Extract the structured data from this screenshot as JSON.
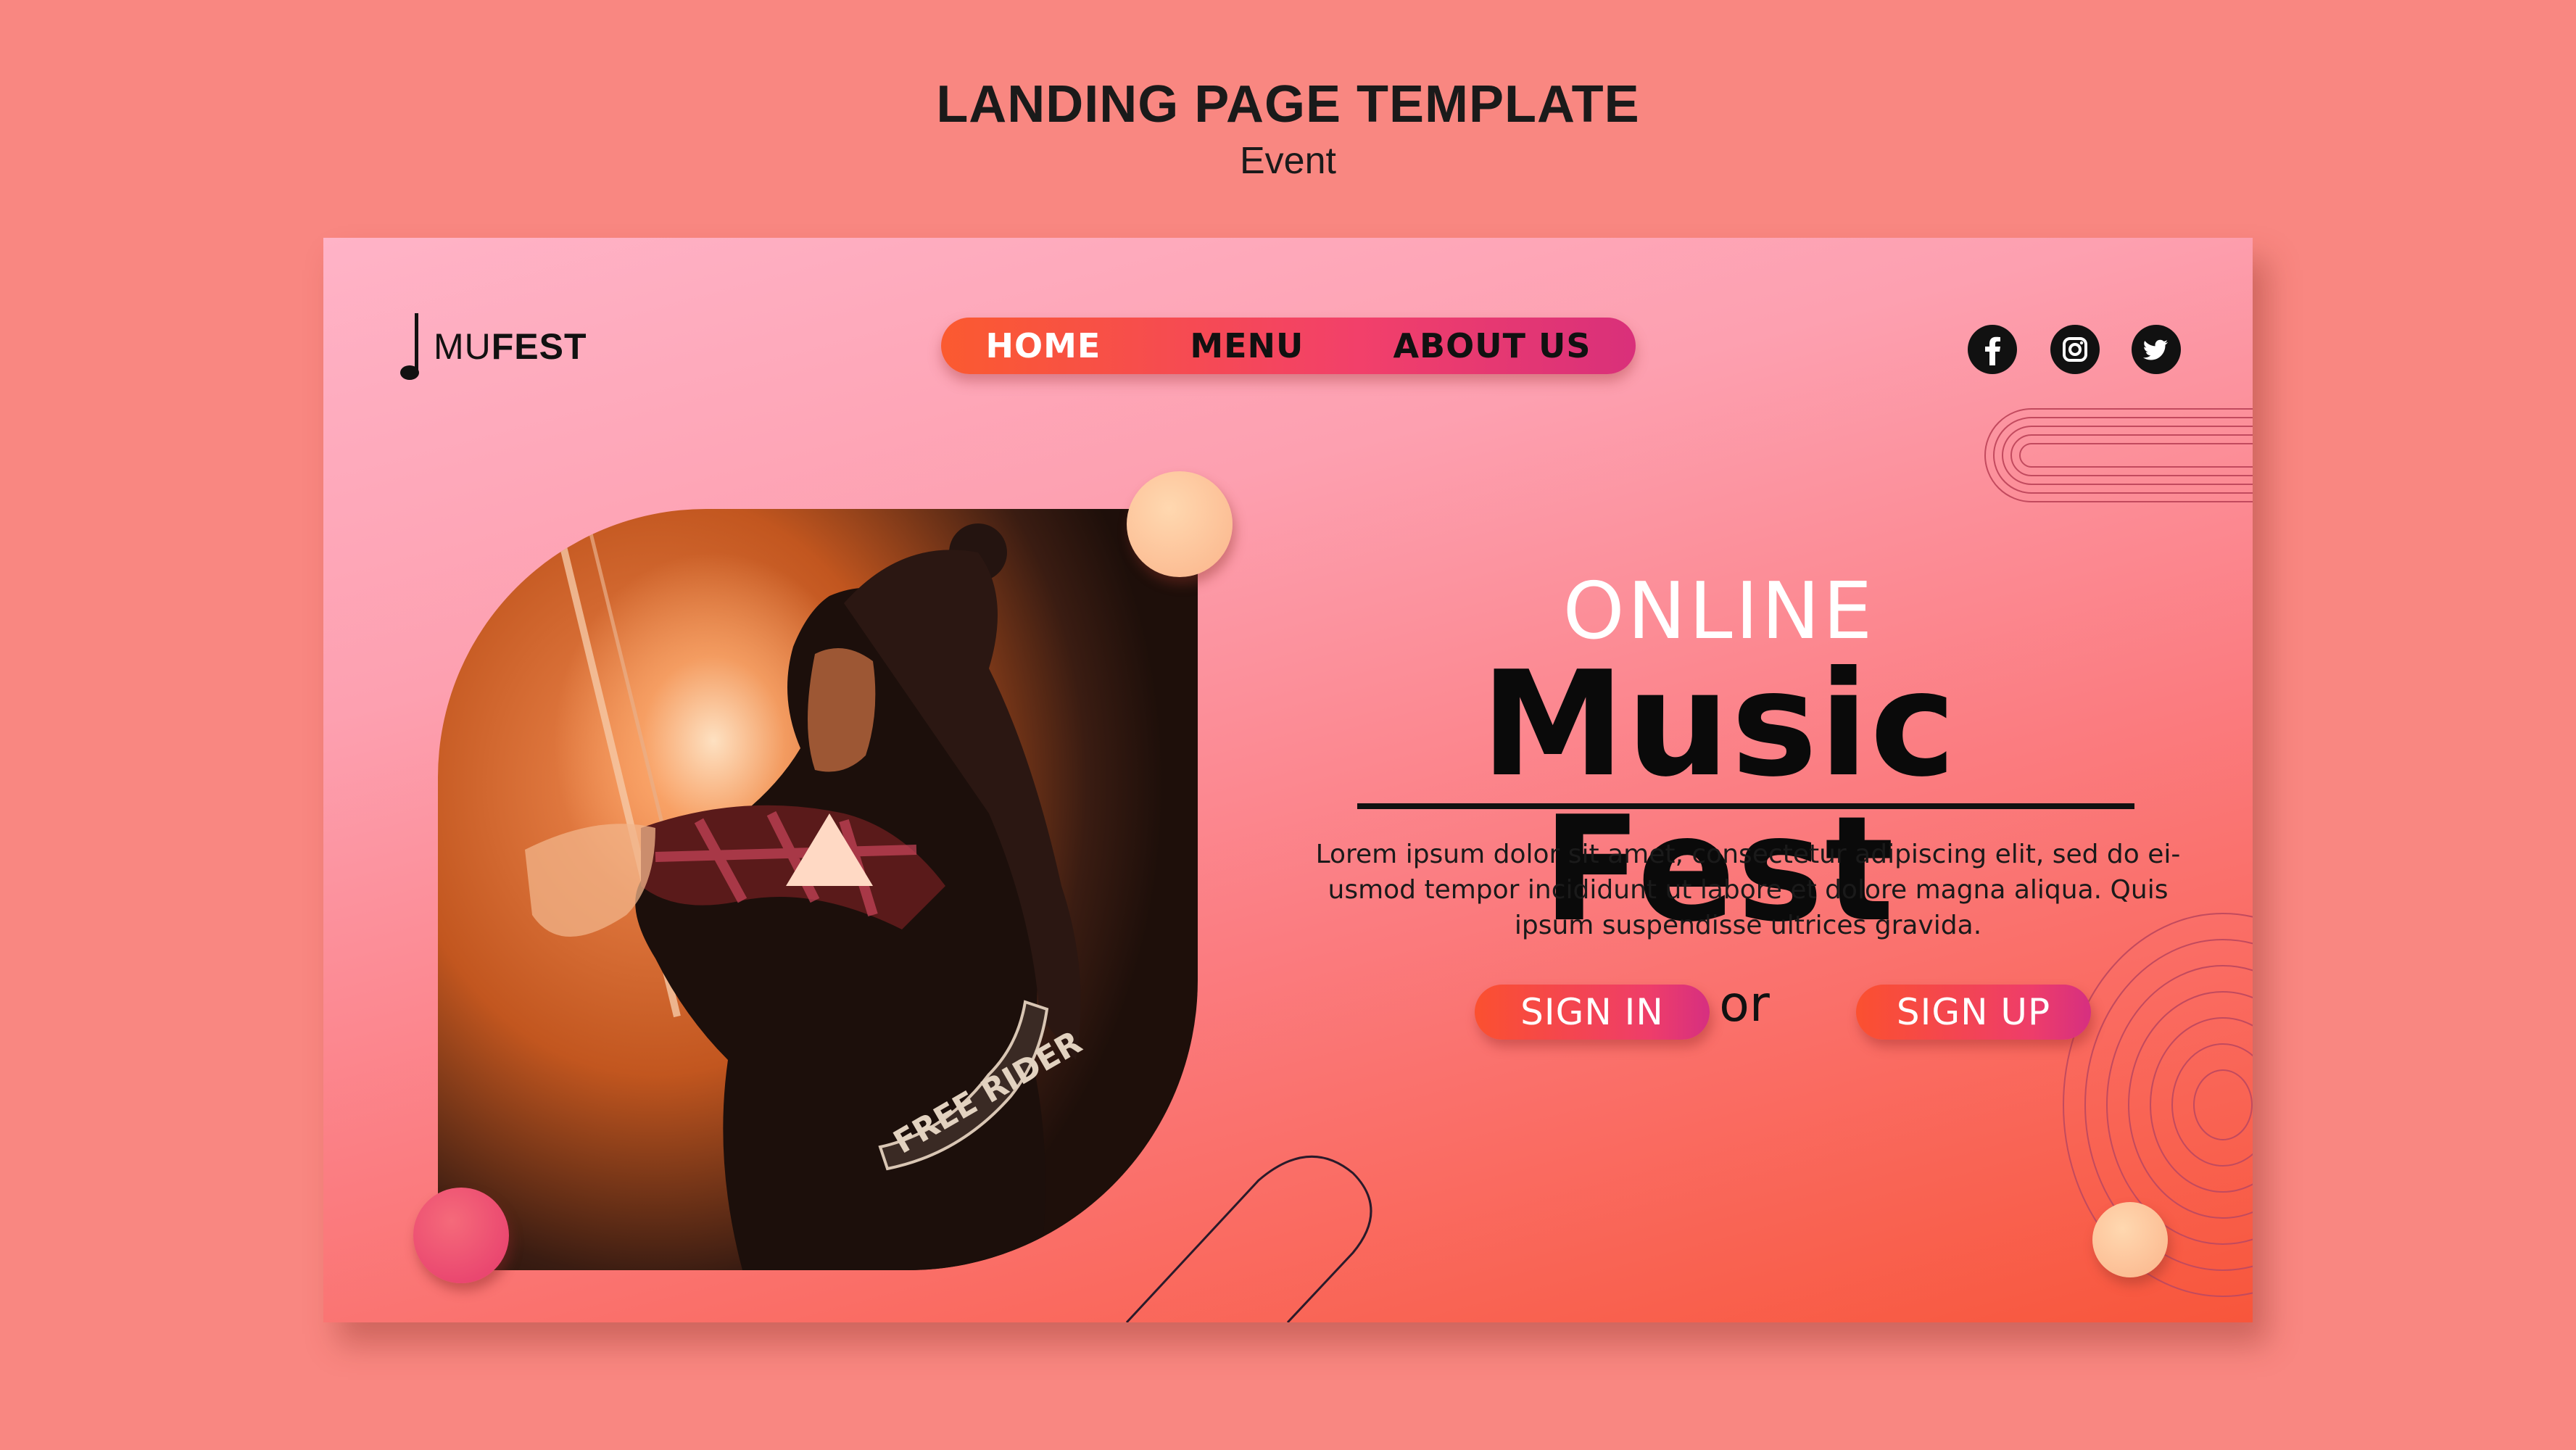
{
  "page": {
    "heading": "LANDING PAGE TEMPLATE",
    "subheading": "Event"
  },
  "site": {
    "logo_light": "MU",
    "logo_bold": "FEST"
  },
  "nav": {
    "items": [
      {
        "label": "HOME",
        "color": "#ffffff"
      },
      {
        "label": "MENU",
        "color": "#111111"
      },
      {
        "label": "ABOUT US",
        "color": "#111111"
      }
    ]
  },
  "social": [
    "facebook-icon",
    "instagram-icon",
    "twitter-icon"
  ],
  "hero": {
    "eyebrow": "ONLINE",
    "title": "Music Fest",
    "description_lines": [
      "Lorem ipsum dolor sit amet, consectetur adipiscing elit, sed do ei-",
      "usmod tempor incididunt ut labore et dolore magna aliqua. Quis",
      "ipsum suspendisse ultrices gravida."
    ],
    "sign_in_label": "SIGN IN",
    "or_label": "or",
    "sign_up_label": "SIGN UP",
    "jacket_patch_text": "FREE RIDER"
  },
  "colors": {
    "background": "#f98781",
    "accent_orange": "#fb5030",
    "accent_pink": "#ee3d6a",
    "card_top": "#ffb3c7"
  }
}
